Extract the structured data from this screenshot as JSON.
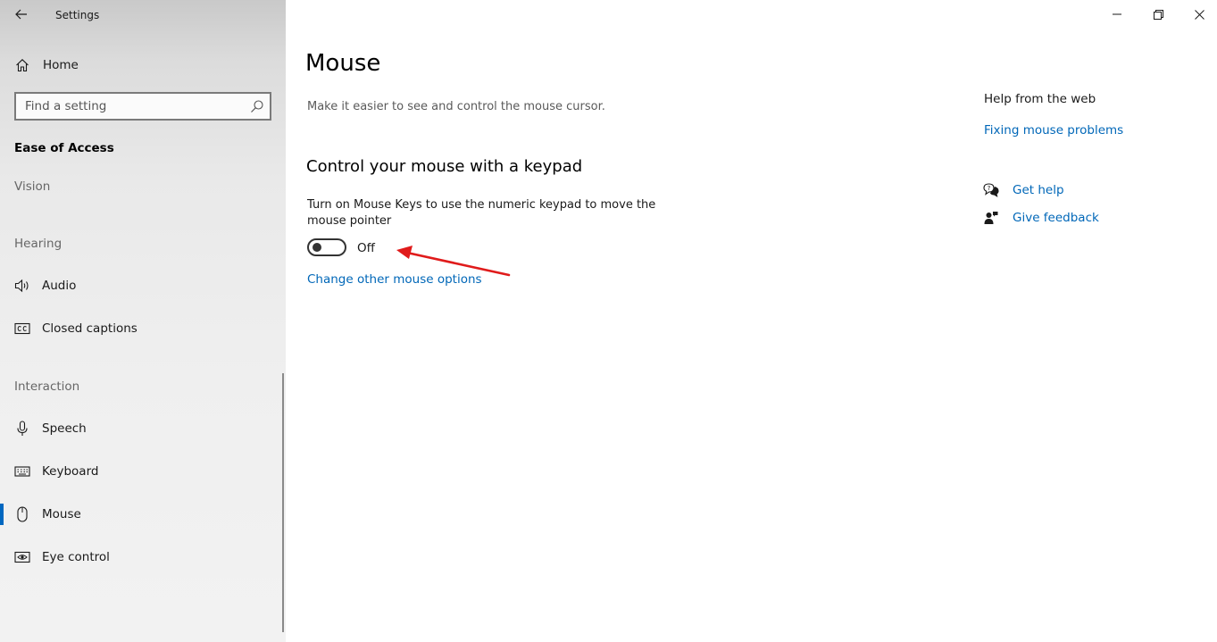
{
  "window": {
    "title": "Settings"
  },
  "sidebar": {
    "home_label": "Home",
    "search_placeholder": "Find a setting",
    "section_title": "Ease of Access",
    "groups": {
      "vision": "Vision",
      "hearing": "Hearing",
      "interaction": "Interaction"
    },
    "items": {
      "audio": "Audio",
      "closed_captions": "Closed captions",
      "speech": "Speech",
      "keyboard": "Keyboard",
      "mouse": "Mouse",
      "eye_control": "Eye control"
    },
    "selected_item": "Mouse"
  },
  "main": {
    "page_title": "Mouse",
    "page_description": "Make it easier to see and control the mouse cursor.",
    "section_title": "Control your mouse with a keypad",
    "toggle_description": "Turn on Mouse Keys to use the numeric keypad to move the mouse pointer",
    "toggle_state": "Off",
    "link_other_options": "Change other mouse options"
  },
  "help": {
    "heading": "Help from the web",
    "link_fixing": "Fixing mouse problems",
    "get_help": "Get help",
    "give_feedback": "Give feedback"
  },
  "colors": {
    "accent": "#0067c0",
    "link": "#0067b8",
    "annotation": "#e01b1b"
  },
  "icons": {
    "back": "back-arrow-icon",
    "home": "home-icon",
    "search": "search-icon",
    "audio": "speaker-icon",
    "closed_captions": "cc-icon",
    "speech": "microphone-icon",
    "keyboard": "keyboard-icon",
    "mouse": "mouse-icon",
    "eye_control": "eye-icon",
    "get_help": "chat-help-icon",
    "give_feedback": "feedback-person-icon"
  }
}
